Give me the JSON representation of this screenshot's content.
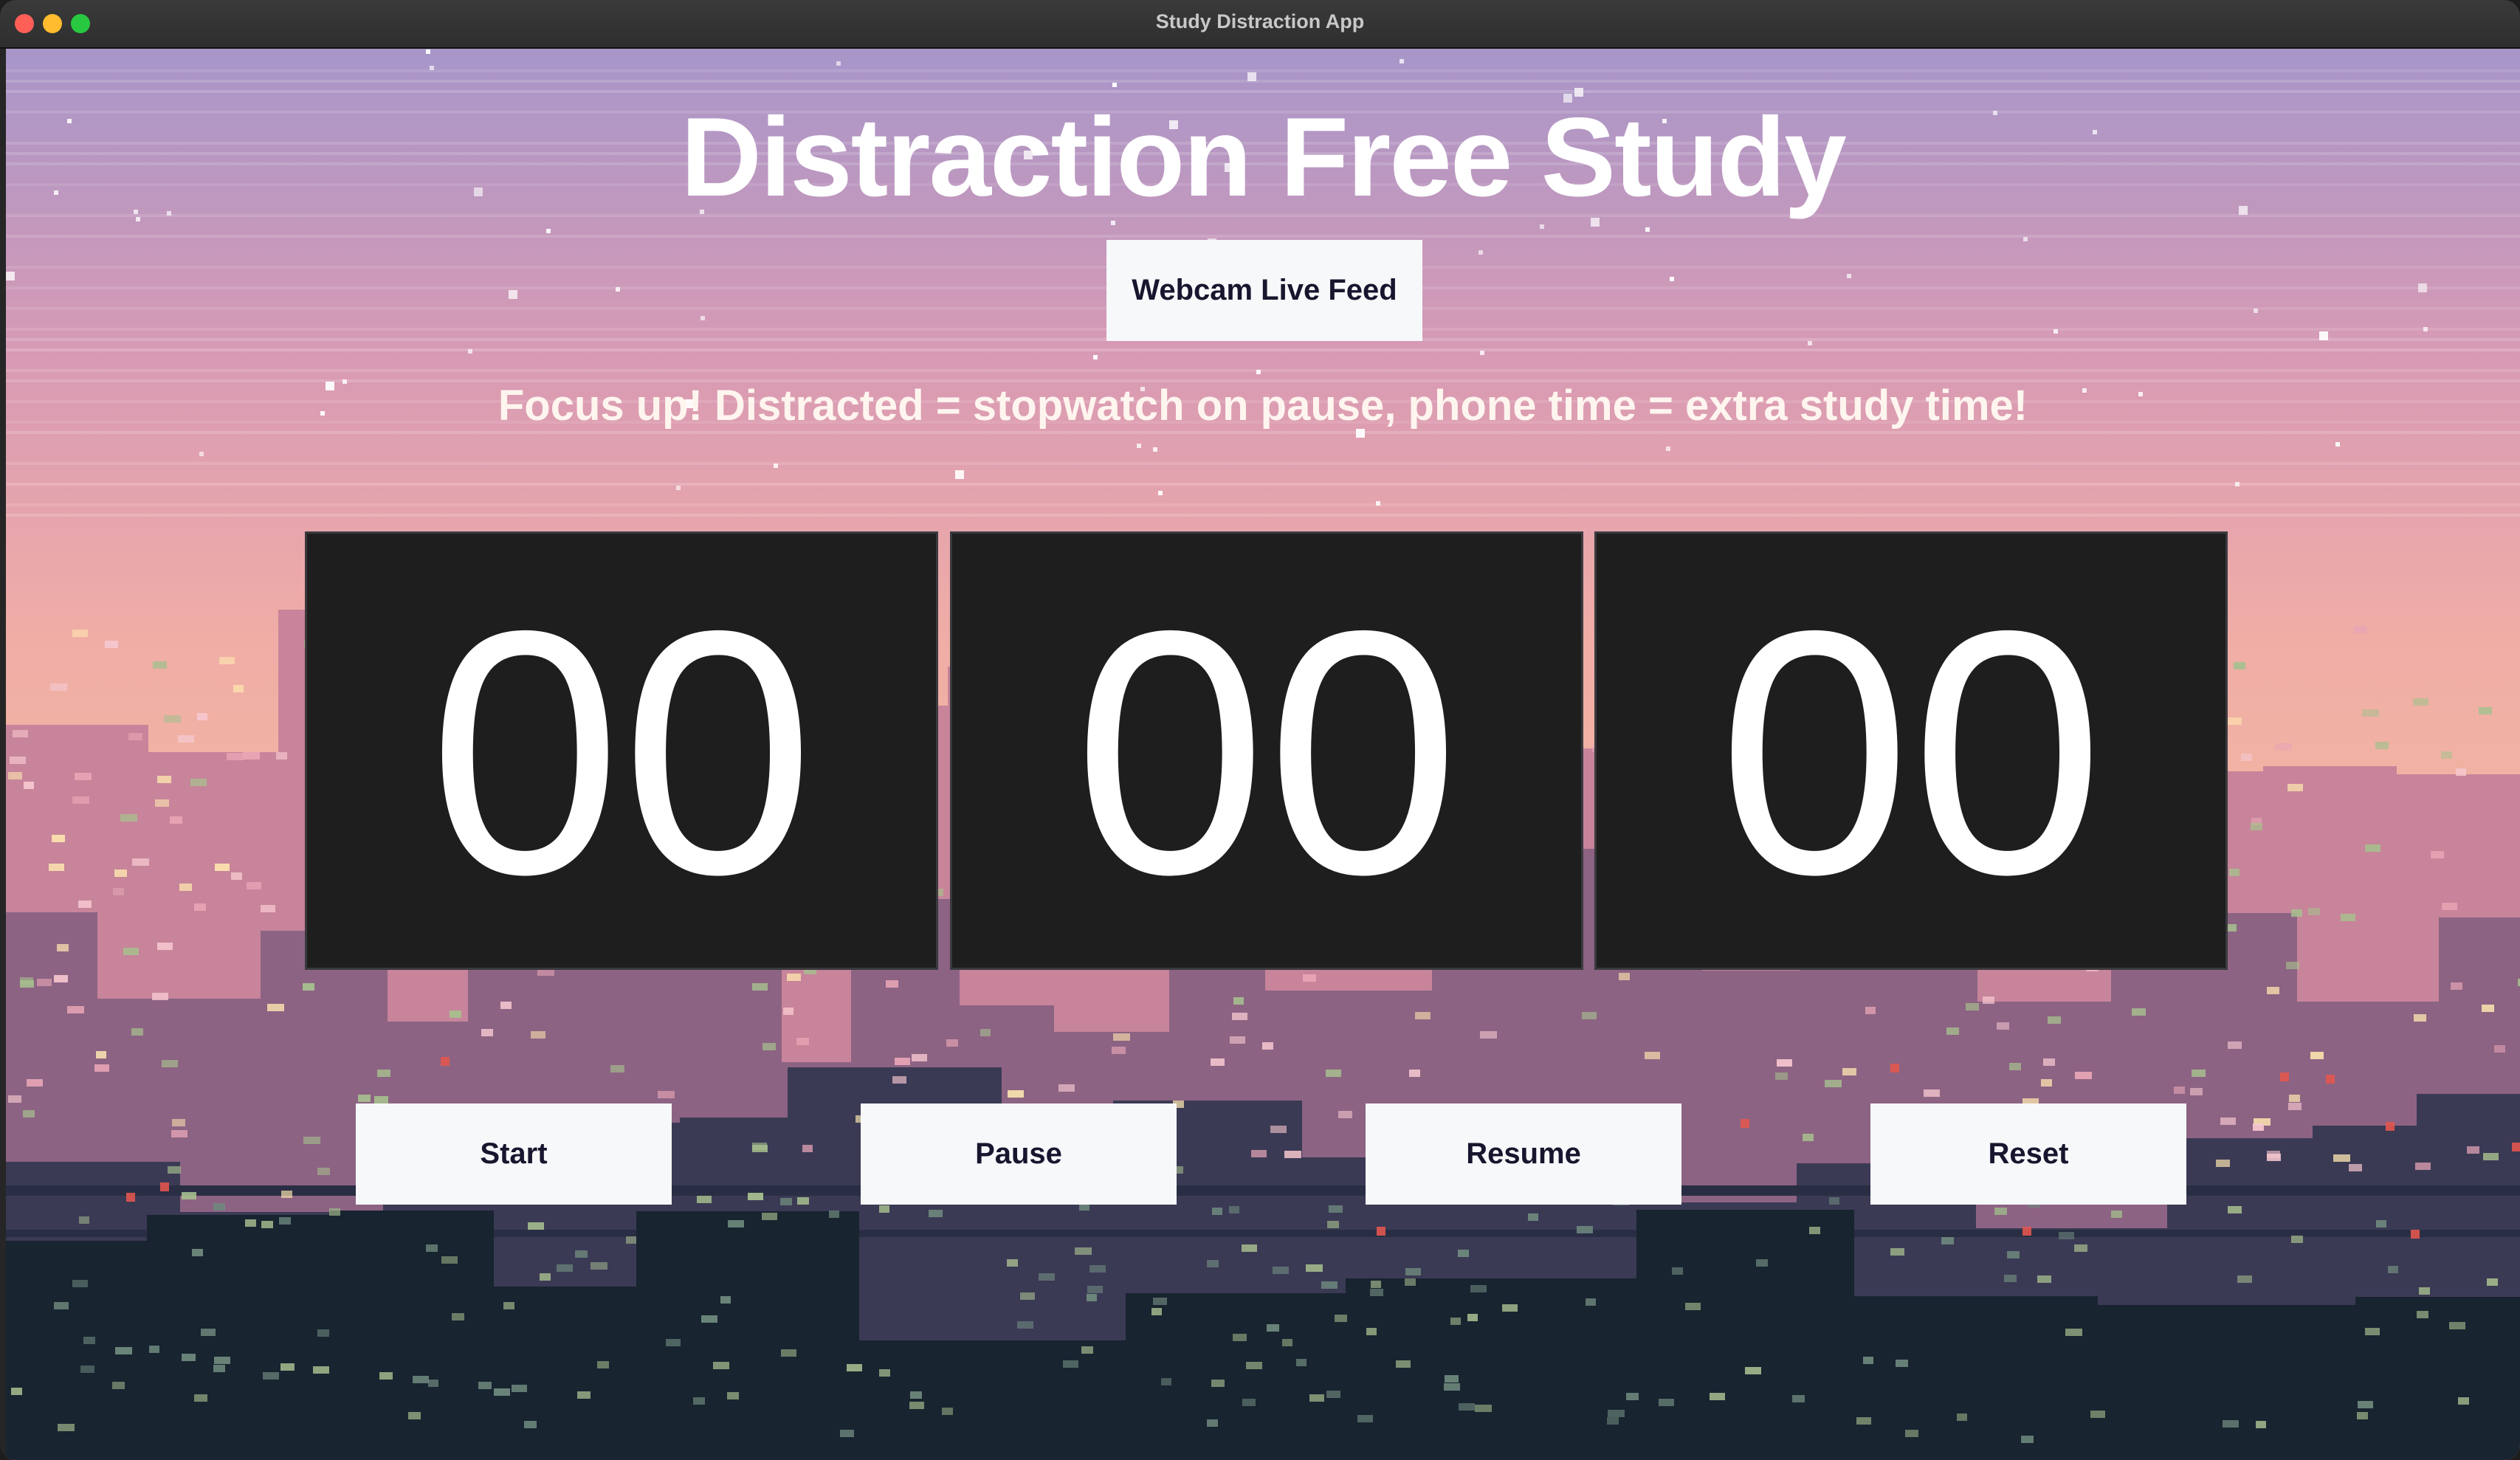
{
  "window": {
    "title": "Study Distraction App"
  },
  "main": {
    "title": "Distraction Free Study",
    "webcam_button": "Webcam Live Feed",
    "tagline": "Focus up! Distracted = stopwatch on pause, phone time = extra study time!"
  },
  "timer": {
    "hours": "00",
    "minutes": "00",
    "seconds": "00"
  },
  "controls": {
    "start": "Start",
    "pause": "Pause",
    "resume": "Resume",
    "reset": "Reset"
  },
  "colors": {
    "sky_top": "#b79ac7",
    "sky_mid": "#e6a4a6",
    "sky_bottom": "#f4b9a1",
    "timer_box": "#1e1e1e",
    "button_bg": "#f6f8fa",
    "button_text": "#16162e"
  }
}
